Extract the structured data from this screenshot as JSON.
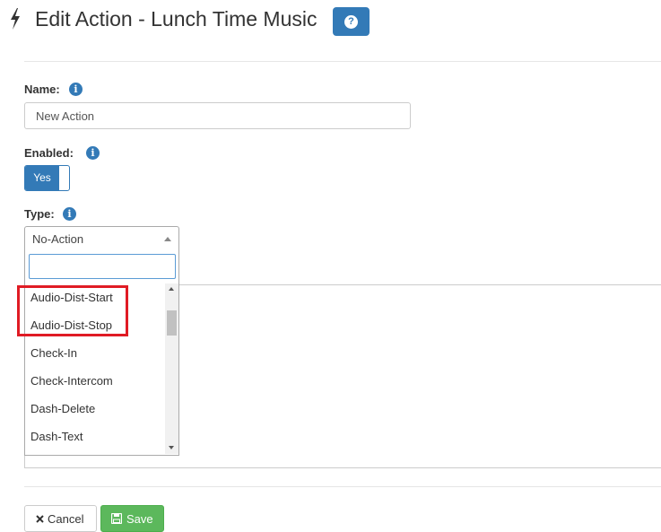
{
  "header": {
    "title": "Edit Action - Lunch Time Music",
    "help_icon": "question-circle-icon",
    "bolt_icon": "bolt-icon"
  },
  "form": {
    "name": {
      "label": "Name:",
      "value": "New Action",
      "placeholder": ""
    },
    "enabled": {
      "label": "Enabled:",
      "toggle_label": "Yes",
      "state": "on"
    },
    "type": {
      "label": "Type:",
      "selected": "No-Action",
      "search_value": "",
      "options": [
        "Audio-Dist-Start",
        "Audio-Dist-Stop",
        "Check-In",
        "Check-Intercom",
        "Dash-Delete",
        "Dash-Text"
      ],
      "highlighted_options": [
        "Audio-Dist-Start",
        "Audio-Dist-Stop"
      ]
    }
  },
  "buttons": {
    "cancel": "Cancel",
    "save": "Save"
  },
  "colors": {
    "primary": "#337ab7",
    "success": "#5cb85c",
    "highlight": "#e01b24"
  }
}
